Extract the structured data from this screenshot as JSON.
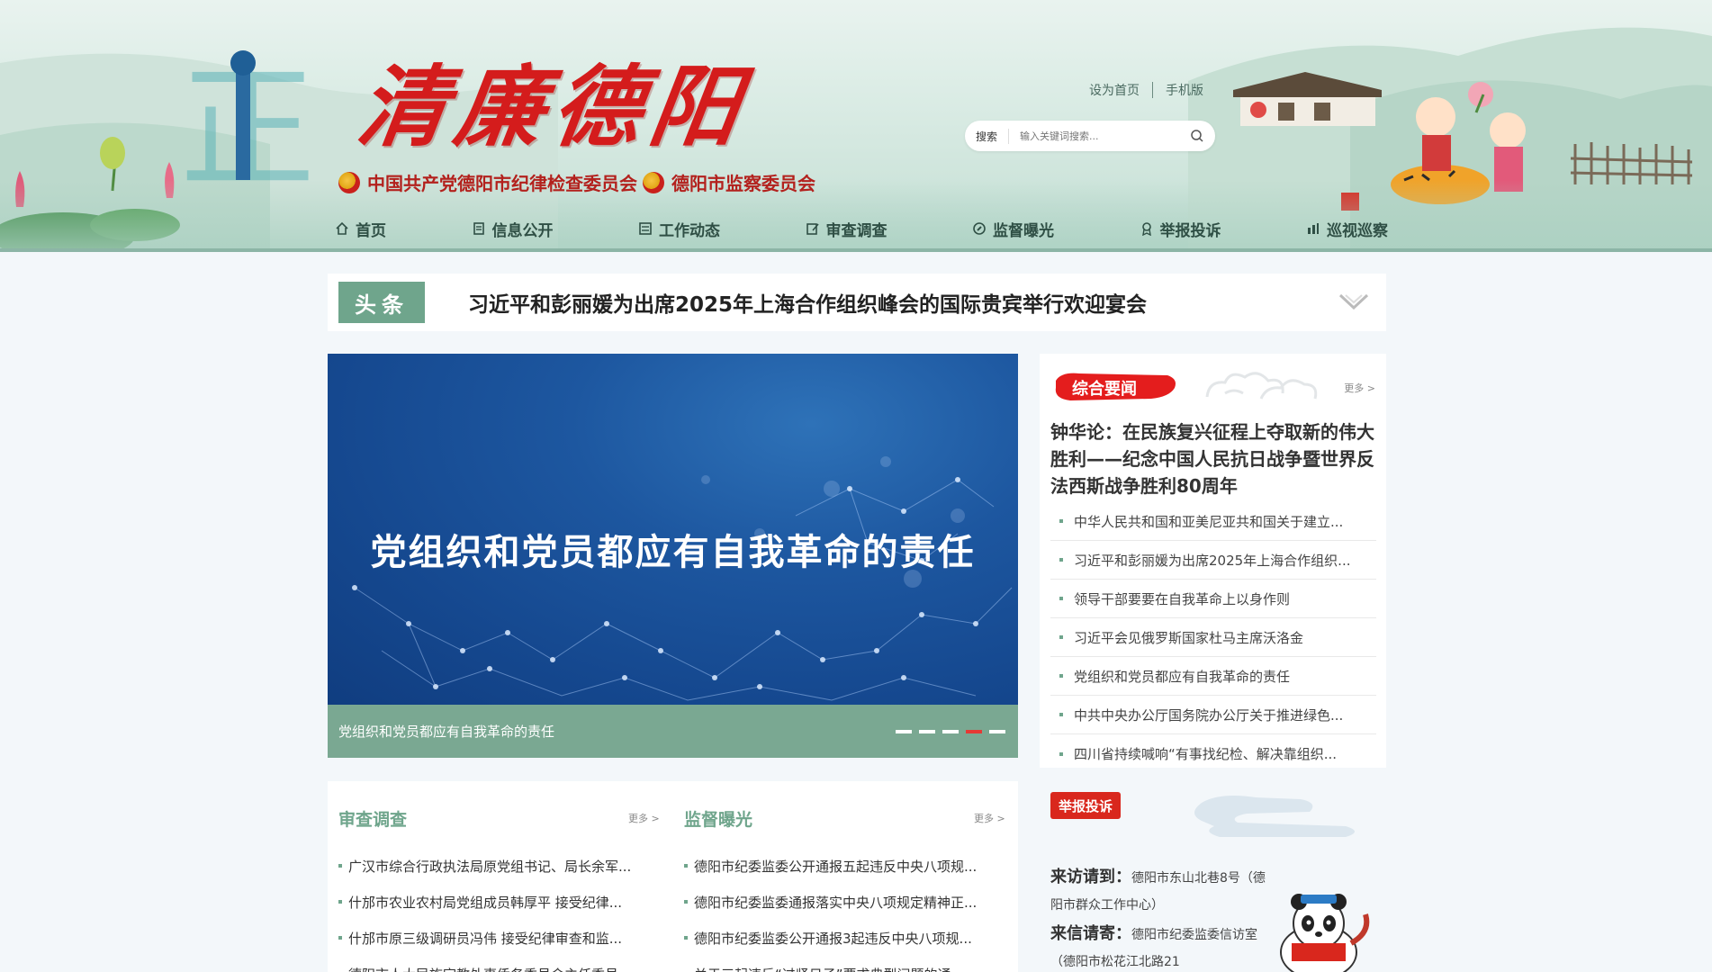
{
  "header": {
    "logo_text": "清廉德阳",
    "org_primary": "中国共产党德阳市纪律检查委员会",
    "org_secondary": "德阳市监察委员会",
    "top_links": [
      "设为首页",
      "手机版"
    ],
    "search": {
      "label": "搜索",
      "placeholder": "输入关键词搜索..."
    }
  },
  "nav": {
    "items": [
      {
        "label": "首页",
        "icon": "home-icon"
      },
      {
        "label": "信息公开",
        "icon": "document-icon"
      },
      {
        "label": "工作动态",
        "icon": "list-icon"
      },
      {
        "label": "审查调查",
        "icon": "edit-icon"
      },
      {
        "label": "监督曝光",
        "icon": "compass-icon"
      },
      {
        "label": "举报投诉",
        "icon": "badge-icon"
      },
      {
        "label": "巡视巡察",
        "icon": "bar-chart-icon"
      }
    ]
  },
  "headline": {
    "tag": "头条",
    "title": "习近平和彭丽媛为出席2025年上海合作组织峰会的国际贵宾举行欢迎宴会"
  },
  "carousel": {
    "image_text": "党组织和党员都应有自我革命的责任",
    "caption": "党组织和党员都应有自我革命的责任",
    "slide_count": 5,
    "active_index": 3
  },
  "news": {
    "tag": "综合要闻",
    "more": "更多 >",
    "lead": "钟华论：在民族复兴征程上夺取新的伟大胜利——纪念中国人民抗日战争暨世界反法西斯战争胜利80周年",
    "items": [
      "中华人民共和国和亚美尼亚共和国关于建立...",
      "习近平和彭丽媛为出席2025年上海合作组织...",
      "领导干部要要在自我革命上以身作则",
      "习近平会见俄罗斯国家杜马主席沃洛金",
      "党组织和党员都应有自我革命的责任",
      "中共中央办公厅国务院办公厅关于推进绿色...",
      "四川省持续喊响“有事找纪检、解决靠组织..."
    ]
  },
  "columns": [
    {
      "title": "审查调查",
      "more": "更多 >",
      "items": [
        "广汉市综合行政执法局原党组书记、局长余军...",
        "什邡市农业农村局党组成员韩厚平 接受纪律...",
        "什邡市原三级调研员冯伟 接受纪律审查和监...",
        "德阳市人大民族宗教外事侨务委员会主任委员..."
      ]
    },
    {
      "title": "监督曝光",
      "more": "更多 >",
      "items": [
        "德阳市纪委监委公开通报五起违反中央八项规...",
        "德阳市纪委监委通报落实中央八项规定精神正...",
        "德阳市纪委监委公开通报3起违反中央八项规...",
        "关于三起违反“过紧日子”要求典型问题的通..."
      ]
    }
  ],
  "report": {
    "tag": "举报投诉",
    "visit_label": "来访请到：",
    "visit_text": "德阳市东山北巷8号（德阳市群众工作中心）",
    "letter_label": "来信请寄：",
    "letter_text": "德阳市纪委监委信访室（德阳市松花江北路21"
  },
  "colors": {
    "accent_green": "#6fa58c",
    "brand_red": "#d41c1c",
    "nav_text": "#2f4f45",
    "active_dot": "#e53935"
  }
}
